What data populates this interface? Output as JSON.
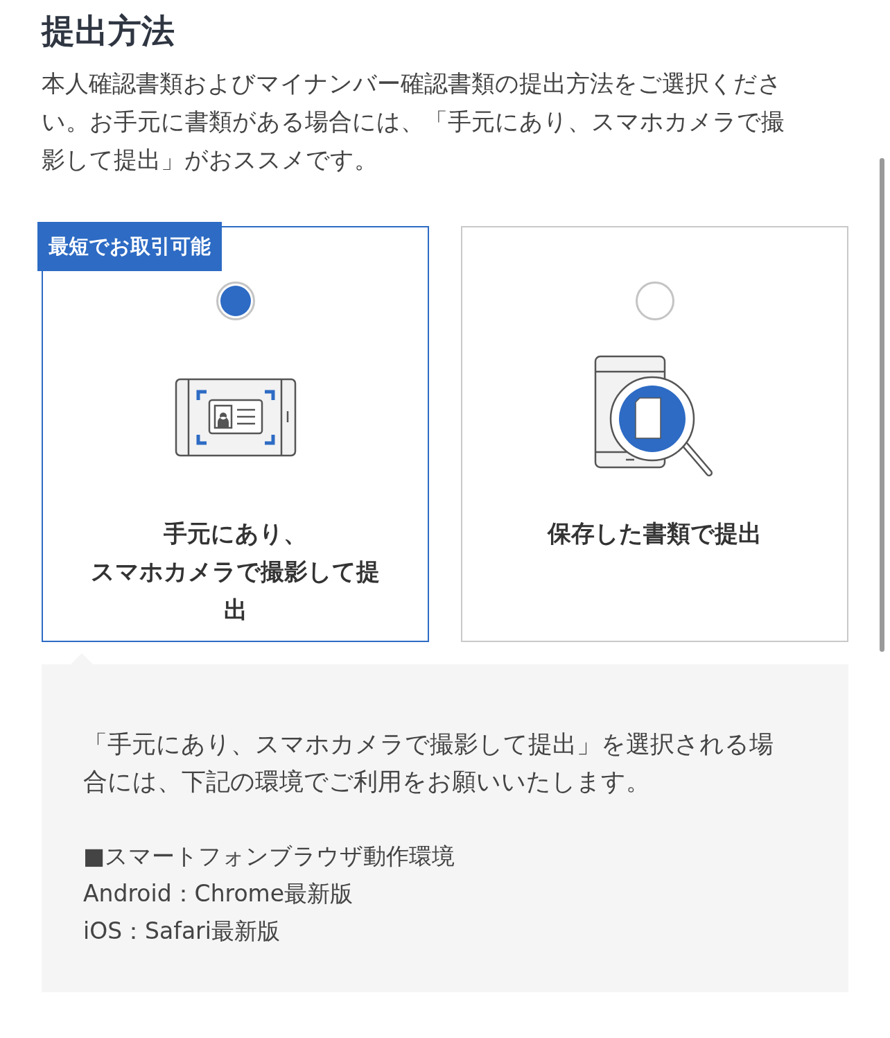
{
  "heading": "提出方法",
  "intro": "本人確認書類およびマイナンバー確認書類の提出方法をご選択ください。お手元に書類がある場合には、「手元にあり、スマホカメラで撮影して提出」がおススメです。",
  "options": [
    {
      "kind": "camera",
      "selected": true,
      "badge": "最短でお取引可能",
      "label_lines": [
        "手元にあり、",
        "スマホカメラで撮影して提出"
      ]
    },
    {
      "kind": "stored",
      "selected": false,
      "label_lines": [
        "保存した書類で提出"
      ]
    }
  ],
  "info": {
    "message": "「手元にあり、スマホカメラで撮影して提出」を選択される場合には、下記の環境でご利用をお願いいたします。",
    "lines": [
      "■スマートフォンブラウザ動作環境",
      "Android：Chrome最新版",
      "iOS：Safari最新版"
    ]
  }
}
